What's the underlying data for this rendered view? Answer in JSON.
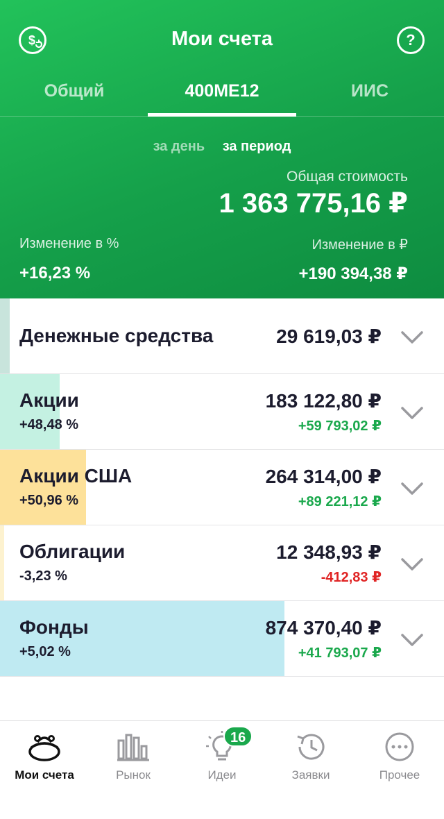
{
  "header": {
    "title": "Мои счета",
    "left_icon": "dollar-refresh-icon",
    "right_icon": "help-icon",
    "help_symbol": "?"
  },
  "tabs": [
    {
      "label": "Общий",
      "active": false
    },
    {
      "label": "400МЕ12",
      "active": true
    },
    {
      "label": "ИИС",
      "active": false
    }
  ],
  "periods": {
    "day": "за день",
    "period": "за период"
  },
  "summary": {
    "total_label": "Общая стоимость",
    "total_value": "1 363 775,16 ₽",
    "pct_label": "Изменение в %",
    "pct_value": "+16,23 %",
    "rub_label": "Изменение в ₽",
    "rub_value": "+190 394,38 ₽"
  },
  "rows": [
    {
      "name": "Денежные средства",
      "amount": "29 619,03 ₽",
      "pct": "",
      "delta": "",
      "share": 0.022,
      "bar_color": "#c8e4dc"
    },
    {
      "name": "Акции",
      "amount": "183 122,80 ₽",
      "pct": "+48,48 %",
      "delta": "+59 793,02 ₽",
      "share": 0.134,
      "bar_color": "#c4f1e2"
    },
    {
      "name": "Акции США",
      "amount": "264 314,00 ₽",
      "pct": "+50,96 %",
      "delta": "+89 221,12 ₽",
      "share": 0.194,
      "bar_color": "#fde19a"
    },
    {
      "name": "Облигации",
      "amount": "12 348,93 ₽",
      "pct": "-3,23 %",
      "delta": "-412,83 ₽",
      "share": 0.009,
      "bar_color": "#fdf2cf"
    },
    {
      "name": "Фонды",
      "amount": "874 370,40 ₽",
      "pct": "+5,02 %",
      "delta": "+41 793,07 ₽",
      "share": 0.641,
      "bar_color": "#bfeaf2"
    }
  ],
  "colors": {
    "accent": "#1aa84c",
    "positive": "#1aa84c",
    "negative": "#e02424",
    "text": "#1c1c2e"
  },
  "tabbar": {
    "items": [
      {
        "label": "Мои счета",
        "icon": "wallet-icon",
        "active": true
      },
      {
        "label": "Рынок",
        "icon": "market-bars-icon",
        "active": false
      },
      {
        "label": "Идеи",
        "icon": "lightbulb-icon",
        "active": false,
        "badge": "16"
      },
      {
        "label": "Заявки",
        "icon": "history-clock-icon",
        "active": false
      },
      {
        "label": "Прочее",
        "icon": "more-dots-icon",
        "active": false
      }
    ]
  }
}
